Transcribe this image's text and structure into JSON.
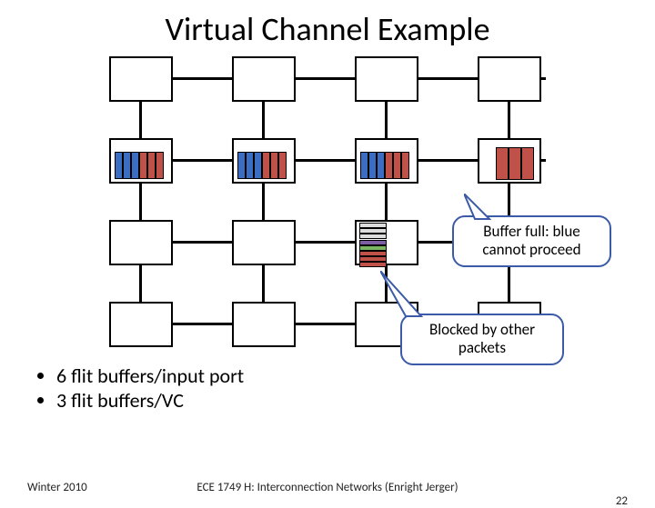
{
  "title": "Virtual Channel Example",
  "callouts": {
    "buffer_full": "Buffer full: blue cannot proceed",
    "blocked": "Blocked by other packets"
  },
  "bullets": [
    "6 flit buffers/input port",
    "3 flit buffers/VC"
  ],
  "footer": {
    "left": "Winter 2010",
    "center": "ECE 1749 H: Interconnection Networks (Enright Jerger)",
    "right": "22"
  },
  "colors": {
    "blue": "#3b6dc2",
    "red": "#c05148",
    "green": "#7bb662",
    "purple": "#7b5fa0",
    "border": "#3b5aa7"
  },
  "grid": {
    "rows": 4,
    "cols": 4
  },
  "buffers": {
    "row1": [
      {
        "orientation": "v",
        "slots": [
          "blue",
          "blue",
          "blue",
          "red",
          "red",
          "red"
        ]
      },
      {
        "orientation": "v",
        "slots": [
          "blue",
          "blue",
          "blue",
          "red",
          "red",
          "red"
        ]
      },
      {
        "orientation": "v",
        "slots": [
          "blue",
          "blue",
          "blue",
          "red",
          "red",
          "red"
        ]
      },
      {
        "orientation": "v",
        "slots": [
          "red",
          "red",
          "red"
        ]
      }
    ],
    "center_node_22": [
      {
        "orientation": "h",
        "slots": [
          "gray",
          "gray",
          "gray"
        ]
      },
      {
        "orientation": "h",
        "slots": [
          "purple",
          "green",
          "red",
          "red",
          "red"
        ]
      }
    ]
  }
}
